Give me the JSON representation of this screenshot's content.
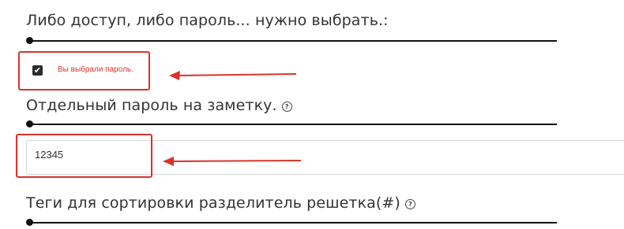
{
  "fields": {
    "access_choice": {
      "label": "Либо доступ, либо пароль... нужно выбрать.:"
    },
    "password_checkbox": {
      "checked": true,
      "check_glyph": "✔",
      "text": "Вы выбрали пароль."
    },
    "note_password": {
      "label": "Отдельный пароль на заметку.",
      "help_glyph": "?",
      "value": "12345"
    },
    "tags": {
      "label": "Теги для сортировки разделитель решетка(#)",
      "help_glyph": "?"
    }
  },
  "colors": {
    "highlight": "#d9332b",
    "text": "#333333",
    "slider": "#111111"
  },
  "icons": [
    "help-circle-icon",
    "checkbox-checked-icon",
    "arrow-left-icon"
  ]
}
